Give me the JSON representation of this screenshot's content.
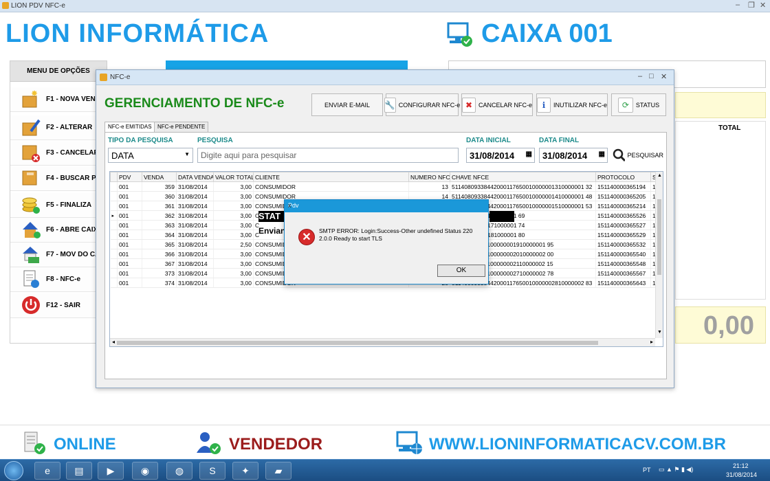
{
  "app_title": "LION PDV NFC-e",
  "brand": "LION INFORMÁTICA",
  "caixa": "CAIXA 001",
  "menu": {
    "header": "MENU DE OPÇÕES",
    "items": [
      {
        "label": "F1 - NOVA VENDA",
        "icon": "box-star-icon"
      },
      {
        "label": "F2 - ALTERAR",
        "icon": "box-pencil-icon"
      },
      {
        "label": "F3 - CANCELAR",
        "icon": "box-cancel-icon"
      },
      {
        "label": "F4 - BUSCAR P",
        "icon": "box-search-icon"
      },
      {
        "label": "F5 - FINALIZA",
        "icon": "coins-icon"
      },
      {
        "label": "F6 - ABRE CAIXA",
        "icon": "house-icon"
      },
      {
        "label": "F7 - MOV DO CAIXA",
        "icon": "house-money-icon"
      },
      {
        "label": "F8 - NFC-e",
        "icon": "document-icon"
      },
      {
        "label": "F12 - SAIR",
        "icon": "power-icon"
      }
    ]
  },
  "total": {
    "header": "TOTAL",
    "value": "0,00"
  },
  "nfce_window": {
    "title": "NFC-e",
    "heading": "GERENCIAMENTO DE NFC-e",
    "toolbar": {
      "enviar": "ENVIAR E-MAIL",
      "configurar": "CONFIGURAR NFC-e",
      "cancelar": "CANCELAR NFC-e",
      "inutilizar": "INUTILIZAR NFC-e",
      "status": "STATUS"
    },
    "tabs": [
      "NFC-e EMITIDAS",
      "NFC-e PENDENTE"
    ],
    "filters": {
      "tipo_label": "TIPO DA PESQUISA",
      "tipo_value": "DATA",
      "pesquisa_label": "PESQUISA",
      "pesquisa_placeholder": "Digite aqui para pesquisar",
      "data_inicial_label": "DATA INICIAL",
      "data_inicial": "31/08/2014",
      "data_final_label": "DATA FINAL",
      "data_final": "31/08/2014",
      "pesquisar": "PESQUISAR"
    },
    "columns": [
      "PDV",
      "VENDA",
      "DATA VENDA",
      "VALOR TOTAL",
      "CLIENTE",
      "NUMERO NFCE",
      "CHAVE NFCE",
      "PROTOCOLO",
      "S"
    ],
    "rows": [
      [
        "001",
        "359",
        "31/08/2014",
        "3,00",
        "CONSUMIDOR",
        "13",
        "51140809338442000117650010000001310000001 32",
        "151140000365194",
        "1"
      ],
      [
        "001",
        "360",
        "31/08/2014",
        "3,00",
        "CONSUMIDOR",
        "14",
        "51140809338442000117650010000001410000001 48",
        "151140000365205",
        "1"
      ],
      [
        "001",
        "361",
        "31/08/2014",
        "3,00",
        "CONSUMIDOR",
        "15",
        "51140809338442000117650010000001510000001 53",
        "151140000365214",
        "1"
      ],
      [
        "001",
        "362",
        "31/08/2014",
        "3,00",
        "C",
        "16",
        "55001000000161000001 69",
        "151140000365526",
        "1"
      ],
      [
        "001",
        "363",
        "31/08/2014",
        "3,00",
        "C",
        "17",
        "55001000000171000001 74",
        "151140000365527",
        "1"
      ],
      [
        "001",
        "364",
        "31/08/2014",
        "3,00",
        "C",
        "18",
        "55001000000181000001 80",
        "151140000365529",
        "1"
      ],
      [
        "001",
        "365",
        "31/08/2014",
        "2,50",
        "CONSUMIDOR",
        "19",
        "20001176500100000001910000001 95",
        "151140000365532",
        "1"
      ],
      [
        "001",
        "366",
        "31/08/2014",
        "3,00",
        "CONSUMIDOR",
        "20",
        "20001176500100000002010000002 00",
        "151140000365540",
        "1"
      ],
      [
        "001",
        "367",
        "31/08/2014",
        "3,00",
        "CONSUMIDOR",
        "21",
        "20001176500100000002110000002 15",
        "151140000365548",
        "1"
      ],
      [
        "001",
        "373",
        "31/08/2014",
        "3,00",
        "CONSUMIDOR",
        "27",
        "20001176500100000002710000002 78",
        "151140000365567",
        "1"
      ],
      [
        "001",
        "374",
        "31/08/2014",
        "3,00",
        "CONSUMIDOR",
        "28",
        "51140809338442000117650010000002810000002 83",
        "151140000365643",
        "1"
      ]
    ],
    "overlay_texts": [
      "STAT",
      "Envian"
    ]
  },
  "dialog": {
    "title": "Pdv",
    "close": "x",
    "message": "SMTP ERROR: Login:Success-Other undefined Status 220 2.0.0 Ready to start TLS",
    "ok": "OK"
  },
  "status_bar": {
    "online": "ONLINE",
    "vendedor": "VENDEDOR",
    "site": "WWW.LIONINFORMATICACV.COM.BR"
  },
  "taskbar": {
    "lang": "PT",
    "time": "21:12",
    "date": "31/08/2014"
  },
  "colors": {
    "brand_blue": "#1e9be8",
    "heading_green": "#1a8a1a",
    "vendedor_red": "#9b1c1c"
  }
}
